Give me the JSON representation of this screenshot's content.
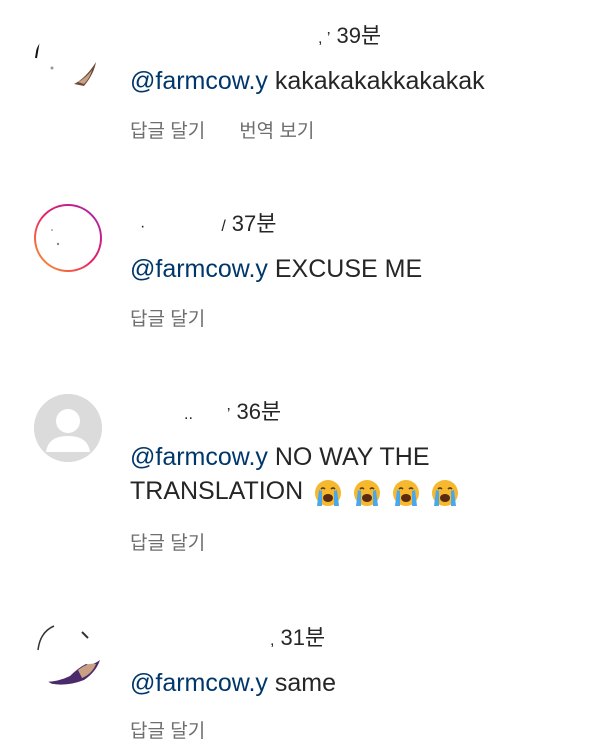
{
  "comments": [
    {
      "time": "39분",
      "mention": "@farmcow.y",
      "text": "kakakakakkakakak",
      "reply_label": "답글 달기",
      "translate_label": "번역 보기",
      "avatar_icon": "profile-photo-icon"
    },
    {
      "time": "37분",
      "mention": "@farmcow.y",
      "text": "EXCUSE ME",
      "reply_label": "답글 달기",
      "avatar_icon": "story-ring-avatar-icon"
    },
    {
      "time": "36분",
      "mention": "@farmcow.y",
      "text": "NO WAY THE",
      "text_line2": "TRANSLATION",
      "emoji_name": "loudly-crying-face-icon",
      "emoji_count": 4,
      "reply_label": "답글 달기",
      "avatar_icon": "default-user-avatar-icon"
    },
    {
      "time": "31분",
      "mention": "@farmcow.y",
      "text": "same",
      "reply_label": "답글 달기",
      "avatar_icon": "profile-photo-icon"
    }
  ],
  "colors": {
    "mention": "#00376b",
    "text": "#262626",
    "secondary": "#6e6e6e",
    "default_avatar_bg": "#d9d9d9",
    "emoji_face": "#f5b82e",
    "emoji_tears": "#4aa8ea"
  }
}
